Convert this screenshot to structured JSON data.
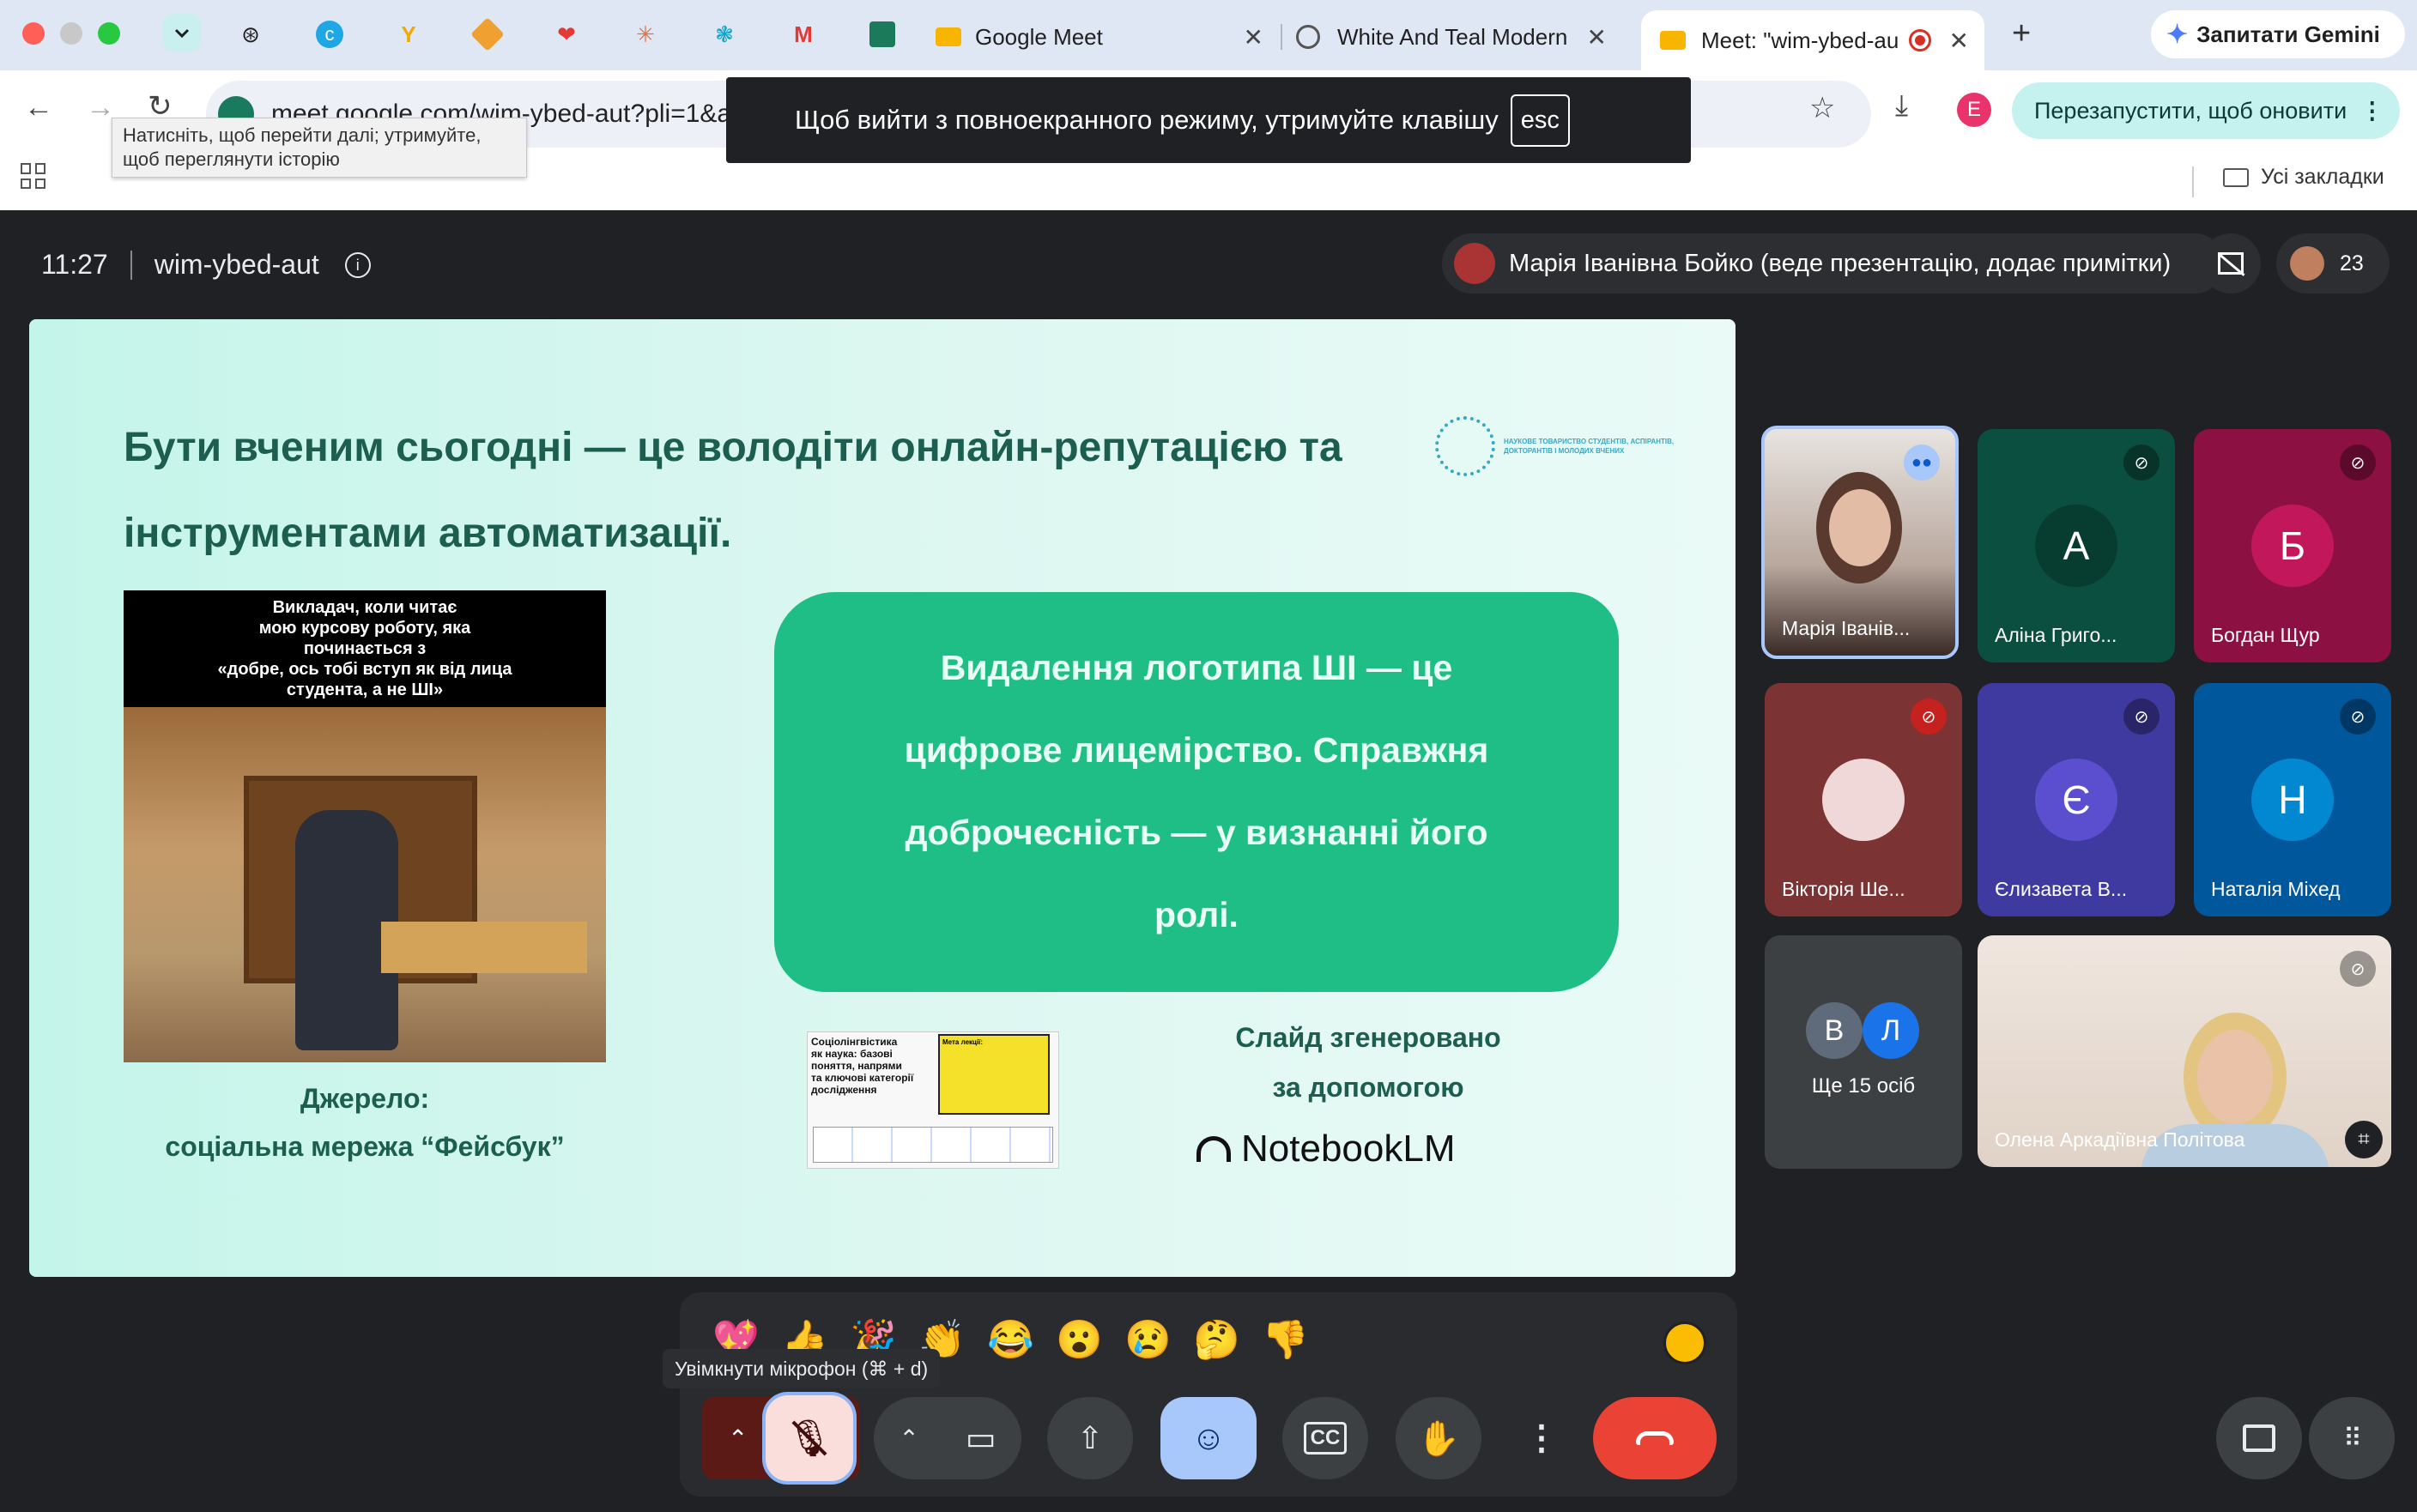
{
  "browser": {
    "pinned_tabs": [
      {
        "icon": "openai-icon"
      },
      {
        "icon": "canva-icon"
      },
      {
        "icon": "yellow-y-icon"
      },
      {
        "icon": "layers-icon"
      },
      {
        "icon": "heart-icon"
      },
      {
        "icon": "claude-icon"
      },
      {
        "icon": "wheel-icon"
      },
      {
        "icon": "gmail-icon"
      },
      {
        "icon": "chart-icon"
      }
    ],
    "tabs": [
      {
        "title": "Google Meet"
      },
      {
        "title": "White And Teal Modern"
      },
      {
        "title": "Meet: \"wim-ybed-au"
      }
    ],
    "gemini_label": "Запитати Gemini",
    "url": "meet.google.com/wim-ybed-aut?pli=1&a",
    "back_tooltip_line1": "Натисніть, щоб перейти далі; утримуйте,",
    "back_tooltip_line2": "щоб переглянути історію",
    "fullscreen_msg": "Щоб вийти з повноекранного режиму, утримуйте клавішу",
    "esc_key": "esc",
    "profile_letter": "E",
    "relaunch_label": "Перезапустити, щоб оновити",
    "bookmarks_label": "Усі закладки"
  },
  "meet": {
    "time": "11:27",
    "code": "wim-ybed-aut",
    "presenter_label": "Марія Іванівна Бойко (веде презентацію, додає примітки)",
    "participant_count": "23",
    "slide": {
      "title_line1": "Бути вченим сьогодні — це володіти онлайн-репутацією та",
      "title_line2": "інструментами автоматизації.",
      "logo_text": "НАУКОВЕ ТОВАРИСТВО СТУДЕНТІВ, АСПІРАНТІВ, ДОКТОРАНТІВ І МОЛОДИХ ВЧЕНИХ",
      "meme_lines": [
        "Викладач, коли читає",
        "мою курсову роботу, яка",
        "починається з",
        "«добре, ось тобі вступ як від лица",
        "студента, а не ШІ»"
      ],
      "source_line1": "Джерело:",
      "source_line2": "соціальна мережа “Фейсбук”",
      "quote_lines": [
        "Видалення логотипа ШІ — це",
        "цифрове лицемірство.  Справжня",
        "доброчесність — у визнанні його",
        "ролі."
      ],
      "thumb_text_lines": [
        "Соціолінгвістика",
        "як наука: базові",
        "поняття, напрями",
        "та ключові категорії",
        "дослідження"
      ],
      "thumb_goal": "Мета лекції:",
      "generated_line1": "Слайд згенеровано",
      "generated_line2": "за допомогою",
      "brand": "NotebookLM"
    },
    "participants": [
      {
        "name": "Марія Іванів...",
        "initial": "",
        "color": "#c9b8b0"
      },
      {
        "name": "Аліна Григо...",
        "initial": "А",
        "color": "#0b5f4e"
      },
      {
        "name": "Богдан Щур",
        "initial": "Б",
        "color": "#c2185b"
      },
      {
        "name": "Вікторія Ше...",
        "initial": "",
        "color": "#8e3a3a"
      },
      {
        "name": "Єлизавета В...",
        "initial": "Є",
        "color": "#5b4fcf"
      },
      {
        "name": "Наталія Міхед",
        "initial": "Н",
        "color": "#0288d1"
      }
    ],
    "more": {
      "initials": [
        "В",
        "Л"
      ],
      "label": "Ще 15 осіб"
    },
    "big_tile_name": "Олена Аркадіївна Політова",
    "mic_tooltip": "Увімкнути мікрофон (⌘ + d)",
    "reactions": [
      "💖",
      "👍",
      "🎉",
      "👏",
      "😂",
      "😮",
      "😢",
      "🤔",
      "👎"
    ]
  }
}
